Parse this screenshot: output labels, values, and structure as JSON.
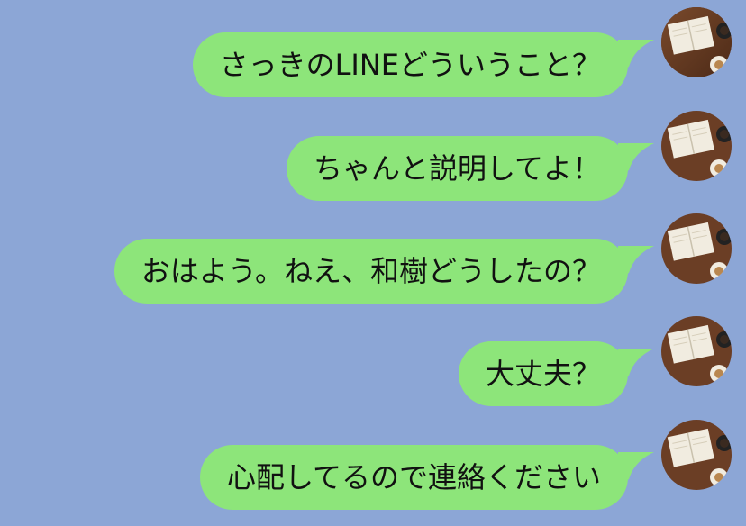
{
  "chat": {
    "messages": [
      {
        "text": "さっきのLINEどういうこと？"
      },
      {
        "text": "ちゃんと説明してよ！"
      },
      {
        "text": "おはよう。ねえ、和樹どうしたの？"
      },
      {
        "text": "大丈夫？"
      },
      {
        "text": "心配してるので連絡ください"
      }
    ],
    "sender_avatar_icon": "book-and-coffee-avatar-icon"
  },
  "colors": {
    "background": "#8ca6d6",
    "bubble": "#8de57a",
    "text": "#111111"
  }
}
